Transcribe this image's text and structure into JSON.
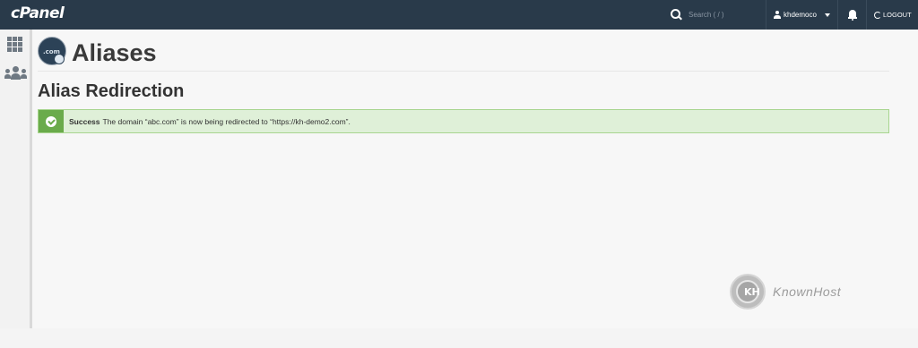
{
  "topbar": {
    "brand": "cPanel",
    "search_placeholder": "Search ( / )",
    "username": "khdemoco",
    "logout_label": "LOGOUT"
  },
  "sidebar": {
    "items": [
      {
        "icon": "grid-icon"
      },
      {
        "icon": "users-icon"
      }
    ]
  },
  "page": {
    "title": "Aliases",
    "icon_text": ".com",
    "section_title": "Alias Redirection"
  },
  "alert": {
    "status": "Success",
    "message": "The domain “abc.com” is now being redirected to “https://kh-demo2.com”.",
    "color": "#dff0d8",
    "accent": "#6aab4b"
  },
  "watermark": {
    "letters": "KH",
    "brand": "KnownHost"
  }
}
